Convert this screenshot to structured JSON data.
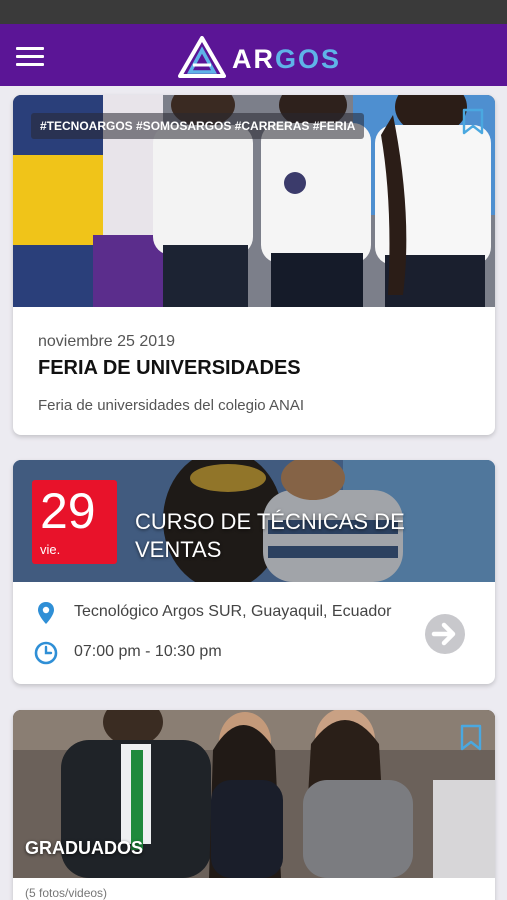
{
  "app": {
    "brand_part1": "AR",
    "brand_part2": "GOS",
    "brand_colors": {
      "bar": "#5b1596",
      "accent": "#5fb3e8"
    },
    "menu_icon": "hamburger-menu-icon"
  },
  "feed": {
    "cards": [
      {
        "kind": "post",
        "tags": "#TECNOARGOS #SOMOSARGOS #CARRERAS #FERIA",
        "date": "noviembre 25 2019",
        "title": "FERIA DE UNIVERSIDADES",
        "description": "Feria de universidades del colegio ANAI",
        "bookmark_icon": "bookmark-icon"
      },
      {
        "kind": "event",
        "day_number": "29",
        "day_name": "vie.",
        "title": "CURSO DE TÉCNICAS DE VENTAS",
        "location": "Tecnológico Argos SUR, Guayaquil, Ecuador",
        "time": "07:00 pm - 10:30 pm",
        "location_icon": "location-pin-icon",
        "time_icon": "clock-icon",
        "action_icon": "arrow-right-circle-icon",
        "accent_color": "#e8122a"
      },
      {
        "kind": "gallery",
        "title": "GRADUADOS",
        "count": "(5 fotos/videos)",
        "bookmark_icon": "bookmark-icon"
      }
    ]
  }
}
